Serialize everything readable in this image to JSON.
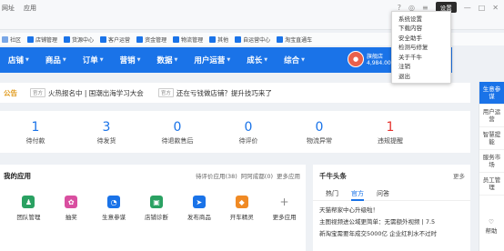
{
  "menu_top": [
    "网址",
    "应用"
  ],
  "window": {
    "tooltip": "设置"
  },
  "bookmarks": [
    {
      "label": "社区",
      "color": "#7aa7e6"
    },
    {
      "label": "店铺管理",
      "color": "#1a73e8"
    },
    {
      "label": "货源中心",
      "color": "#1a73e8"
    },
    {
      "label": "客户运营",
      "color": "#1a73e8"
    },
    {
      "label": "资金管理",
      "color": "#1a73e8"
    },
    {
      "label": "物流管理",
      "color": "#1a73e8"
    },
    {
      "label": "其他",
      "color": "#1a73e8"
    },
    {
      "label": "自运营中心",
      "color": "#1a73e8"
    },
    {
      "label": "淘宝直通车",
      "color": "#1a73e8"
    }
  ],
  "nav": [
    {
      "label": "店铺"
    },
    {
      "label": "商品"
    },
    {
      "label": "订单"
    },
    {
      "label": "营销"
    },
    {
      "label": "数据"
    },
    {
      "label": "用户运营"
    },
    {
      "label": "成长"
    },
    {
      "label": "综合"
    }
  ],
  "user": {
    "line1": "旗舰店",
    "line2": "4,984.00"
  },
  "dropdown": [
    "系统设置",
    "下载内容",
    "安全助手",
    "检测与修复",
    "关于千牛",
    "注销",
    "退出"
  ],
  "rightbar": [
    "生意参谋",
    "用户运营",
    "智慧提能",
    "服务市场",
    "员工管理"
  ],
  "help": "帮助",
  "notice": {
    "tag": "公告",
    "badge": "官方",
    "items": [
      "火热报名中 | 国潮出海学习大会",
      "还在亏钱做店铺？提升技巧来了"
    ]
  },
  "stats": [
    {
      "value": "1",
      "label": "待付款",
      "color": "#1a73e8"
    },
    {
      "value": "3",
      "label": "待发货",
      "color": "#1a73e8"
    },
    {
      "value": "0",
      "label": "待退款售后",
      "color": "#1a73e8"
    },
    {
      "value": "0",
      "label": "待评价",
      "color": "#1a73e8"
    },
    {
      "value": "0",
      "label": "物流异常",
      "color": "#1a73e8"
    },
    {
      "value": "1",
      "label": "违规提醒",
      "color": "#e5322d"
    }
  ],
  "apps": {
    "title": "我的应用",
    "links": [
      "待评价应用(38)",
      "阿阿成都(0)",
      "更多应用"
    ],
    "items": [
      {
        "label": "团队管理",
        "color": "#2aa162",
        "icon": "team-icon"
      },
      {
        "label": "抽奖",
        "color": "#d94fa0",
        "icon": "lottery-icon"
      },
      {
        "label": "生意参谋",
        "color": "#1a73e8",
        "icon": "chart-icon"
      },
      {
        "label": "店铺诊断",
        "color": "#2aa162",
        "icon": "diagnose-icon"
      },
      {
        "label": "发布商品",
        "color": "#1a73e8",
        "icon": "publish-icon"
      },
      {
        "label": "开车精灵",
        "color": "#f08a24",
        "icon": "car-icon"
      },
      {
        "label": "更多应用",
        "color": "#ffffff",
        "icon": "plus-icon"
      }
    ]
  },
  "news": {
    "title": "千牛头条",
    "more": "更多",
    "tabs": [
      "热门",
      "官方",
      "问答"
    ],
    "items": [
      "天猫帮家中心升级啦！",
      "主图视频进公域更简单：无需额外视频 | 7.5",
      "新淘宝需要年成交5000亿 企业红利水不过时"
    ]
  }
}
